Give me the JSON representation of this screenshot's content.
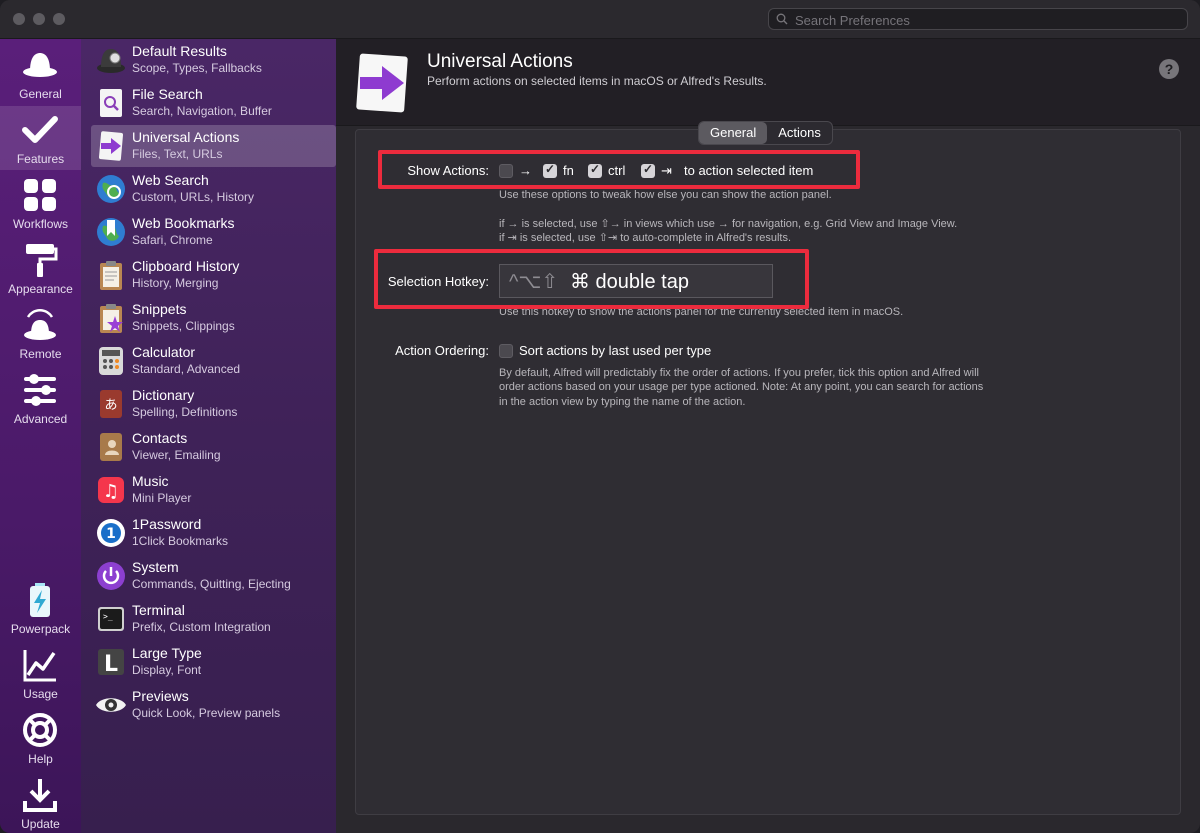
{
  "search": {
    "placeholder": "Search Preferences"
  },
  "rail": [
    {
      "label": "General",
      "icon": "hat-icon"
    },
    {
      "label": "Features",
      "icon": "checkmark-icon"
    },
    {
      "label": "Workflows",
      "icon": "grid-icon"
    },
    {
      "label": "Appearance",
      "icon": "paint-roller-icon"
    },
    {
      "label": "Remote",
      "icon": "remote-hat-icon"
    },
    {
      "label": "Advanced",
      "icon": "sliders-icon"
    },
    {
      "label": "Powerpack",
      "icon": "battery-icon"
    },
    {
      "label": "Usage",
      "icon": "chart-icon"
    },
    {
      "label": "Help",
      "icon": "lifebuoy-icon"
    },
    {
      "label": "Update",
      "icon": "download-icon"
    }
  ],
  "features": [
    {
      "title": "Default Results",
      "subtitle": "Scope, Types, Fallbacks",
      "icon": "default-results-icon"
    },
    {
      "title": "File Search",
      "subtitle": "Search, Navigation, Buffer",
      "icon": "file-search-icon"
    },
    {
      "title": "Universal Actions",
      "subtitle": "Files, Text, URLs",
      "icon": "universal-actions-icon"
    },
    {
      "title": "Web Search",
      "subtitle": "Custom, URLs, History",
      "icon": "web-search-icon"
    },
    {
      "title": "Web Bookmarks",
      "subtitle": "Safari, Chrome",
      "icon": "web-bookmarks-icon"
    },
    {
      "title": "Clipboard History",
      "subtitle": "History, Merging",
      "icon": "clipboard-icon"
    },
    {
      "title": "Snippets",
      "subtitle": "Snippets, Clippings",
      "icon": "snippets-icon"
    },
    {
      "title": "Calculator",
      "subtitle": "Standard, Advanced",
      "icon": "calculator-icon"
    },
    {
      "title": "Dictionary",
      "subtitle": "Spelling, Definitions",
      "icon": "dictionary-icon",
      "glyph": "あ"
    },
    {
      "title": "Contacts",
      "subtitle": "Viewer, Emailing",
      "icon": "contacts-icon"
    },
    {
      "title": "Music",
      "subtitle": "Mini Player",
      "icon": "music-icon",
      "glyph": "♫"
    },
    {
      "title": "1Password",
      "subtitle": "1Click Bookmarks",
      "icon": "onepassword-icon",
      "glyph": "1"
    },
    {
      "title": "System",
      "subtitle": "Commands, Quitting, Ejecting",
      "icon": "system-power-icon"
    },
    {
      "title": "Terminal",
      "subtitle": "Prefix, Custom Integration",
      "icon": "terminal-icon",
      "glyph": ">_"
    },
    {
      "title": "Large Type",
      "subtitle": "Display, Font",
      "icon": "large-type-icon",
      "glyph": "L"
    },
    {
      "title": "Previews",
      "subtitle": "Quick Look, Preview panels",
      "icon": "previews-eye-icon"
    }
  ],
  "header": {
    "title": "Universal Actions",
    "subtitle": "Perform actions on selected items in macOS or Alfred's Results.",
    "help": "?"
  },
  "tabs": {
    "general": "General",
    "actions": "Actions"
  },
  "show_actions": {
    "label": "Show Actions:",
    "opt_right": "→",
    "opt_fn": "fn",
    "opt_ctrl": "ctrl",
    "opt_tab": "⇥",
    "suffix": "to action selected item",
    "hint1": "Use these options to tweak how else you can show the action panel.",
    "hint2": "if → is selected, use ⇧→ in views which use → for navigation, e.g. Grid View and Image View.",
    "hint3": "if ⇥ is selected, use ⇧⇥ to auto-complete in Alfred's results."
  },
  "hotkey": {
    "label": "Selection Hotkey:",
    "modifiers": "^⌥⇧",
    "value": "⌘ double tap",
    "hint": "Use this hotkey to show the actions panel for the currently selected item in macOS."
  },
  "ordering": {
    "label": "Action Ordering:",
    "option": "Sort actions by last used per type",
    "hint1": "By default, Alfred will predictably fix the order of actions. If you prefer, tick this option and Alfred will",
    "hint2": "order actions based on your usage per type actioned. Note: At any point, you can search for actions",
    "hint3": "in the action view by typing the name of the action."
  }
}
